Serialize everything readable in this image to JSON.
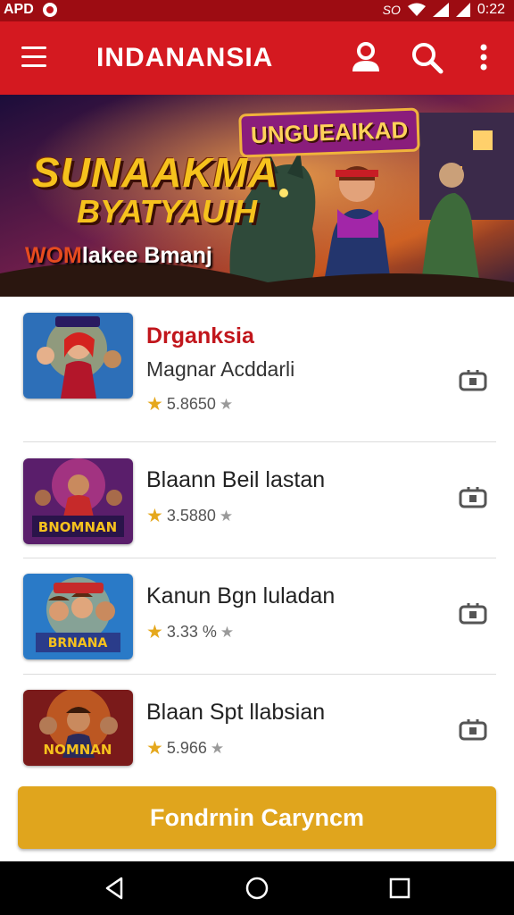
{
  "status_bar": {
    "left_text": "APD",
    "time": "0:22",
    "right_label": "SO"
  },
  "app_bar": {
    "title": "INDANANSIA",
    "menu_icon": "hamburger-icon",
    "profile_icon": "person-icon",
    "search_icon": "search-icon",
    "more_icon": "more-vertical-icon"
  },
  "banner": {
    "badge": "UNGUEAIKAD",
    "headline_1": "SUNAAKMA",
    "headline_2": "BYATYAUIH",
    "tagline_accent": "WOM",
    "tagline": "lakee Bmanj"
  },
  "colors": {
    "primary": "#d41920",
    "status_bar": "#9d0c12",
    "accent": "#e0a51d",
    "featured_name": "#c1161c"
  },
  "games": [
    {
      "name": "Drganksia",
      "subtitle": "Magnar Acddarli",
      "rating": "5.8650",
      "featured": true,
      "thumb_label": ""
    },
    {
      "name": "Blaann Beil lastan",
      "subtitle": "",
      "rating": "3.5880",
      "featured": false,
      "thumb_label": "BNOMNAN"
    },
    {
      "name": "Kanun Bgn luladan",
      "subtitle": "",
      "rating": "3.33 %",
      "featured": false,
      "thumb_label": "BRNANA"
    },
    {
      "name": "Blaan Spt llabsian",
      "subtitle": "",
      "rating": "5.966",
      "featured": false,
      "thumb_label": "NOMNAN"
    }
  ],
  "cta": {
    "label": "Fondrnin Caryncm"
  }
}
